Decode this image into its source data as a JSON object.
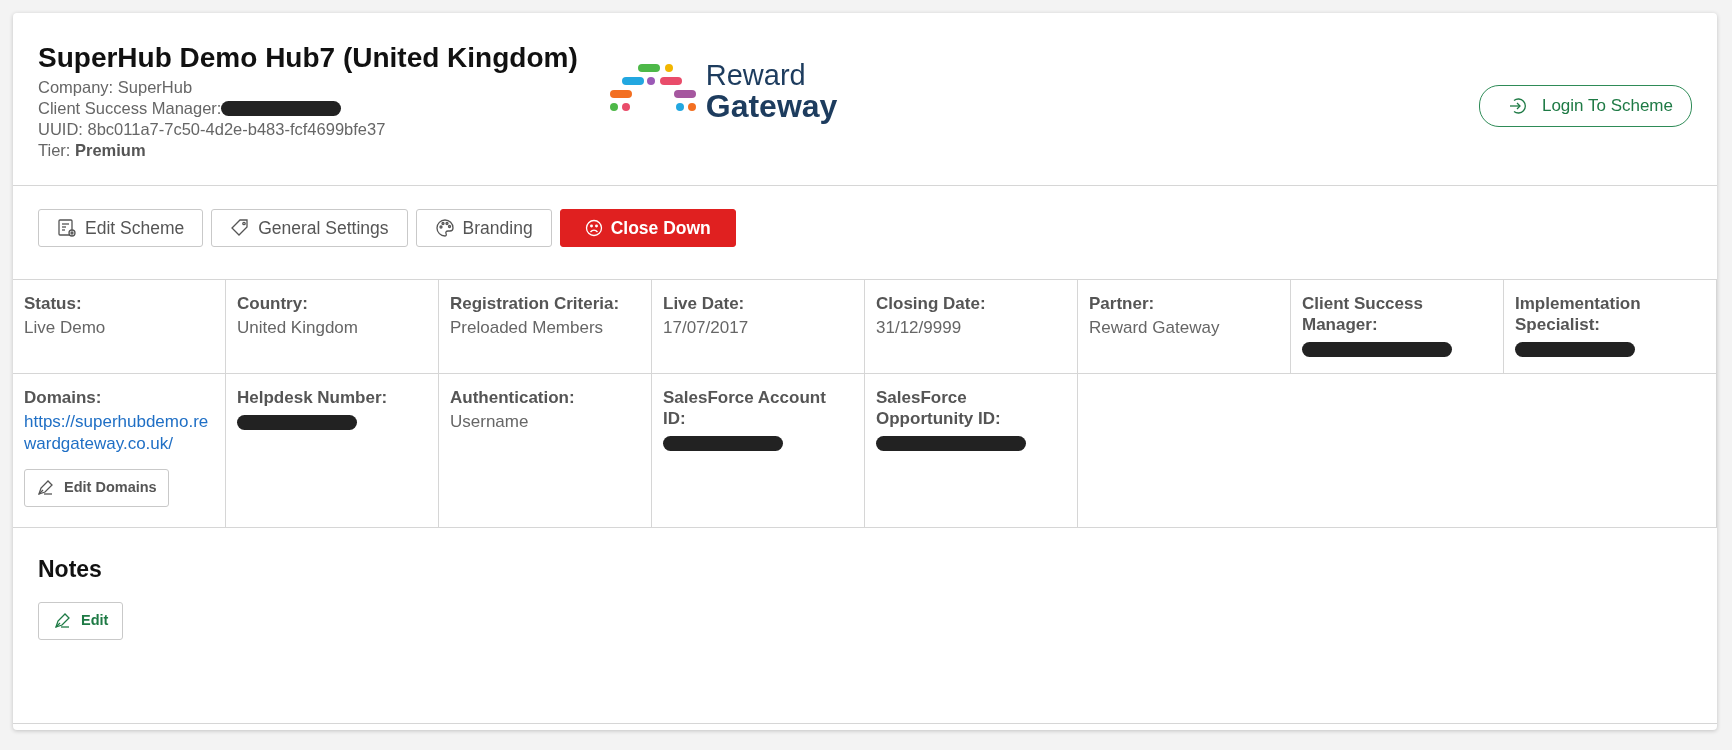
{
  "header": {
    "title": "SuperHub Demo Hub7 (United Kingdom)",
    "lines": [
      {
        "text": "Company: SuperHub"
      },
      {
        "text": "Client Success Manager:",
        "redacted": true
      },
      {
        "text": "UUID: 8bc011a7-7c50-4d2e-b483-fcf4699bfe37"
      },
      {
        "text": "Tier: **Premium**"
      }
    ],
    "logo": {
      "line_1": "Reward",
      "line_2": "Gateway"
    },
    "login_button": "Login To Scheme"
  },
  "actions": [
    {
      "label": "Edit Scheme"
    },
    {
      "label": "General Settings"
    },
    {
      "label": "Branding"
    },
    {
      "label": "Close Down"
    }
  ],
  "rows": [
    [
      {
        "label": "Status:",
        "value": "Live Demo",
        "kind": "text"
      },
      {
        "label": "Country:",
        "value": "United Kingdom",
        "kind": "text"
      },
      {
        "label": "Registration Criteria:",
        "value": "Preloaded Members",
        "kind": "text"
      },
      {
        "label": "Live Date:",
        "value": "17/07/2017",
        "kind": "text"
      },
      {
        "label": "Closing Date:",
        "value": "31/12/9999",
        "kind": "text"
      },
      {
        "label": "Partner:",
        "value": "Reward Gateway",
        "kind": "text"
      },
      {
        "label": "Client Success Manager:",
        "redacted": true
      },
      {
        "label": "Implementation Specialist:",
        "redacted": true
      }
    ],
    [
      {
        "label": "Domains:",
        "value": "https://superhubdemo.rewardgateway.co.uk/",
        "kind": "link",
        "button": "Edit Domains"
      },
      {
        "label": "Helpdesk Number:",
        "redacted": true
      },
      {
        "label": "Authentication:",
        "value": "Username",
        "kind": "text"
      },
      {
        "label": "SalesForce Account ID:",
        "redacted": true
      },
      {
        "label": "SalesForce Opportunity ID:",
        "redacted": true
      }
    ]
  ],
  "notes": {
    "title": "Notes",
    "edit_button": "Edit"
  }
}
